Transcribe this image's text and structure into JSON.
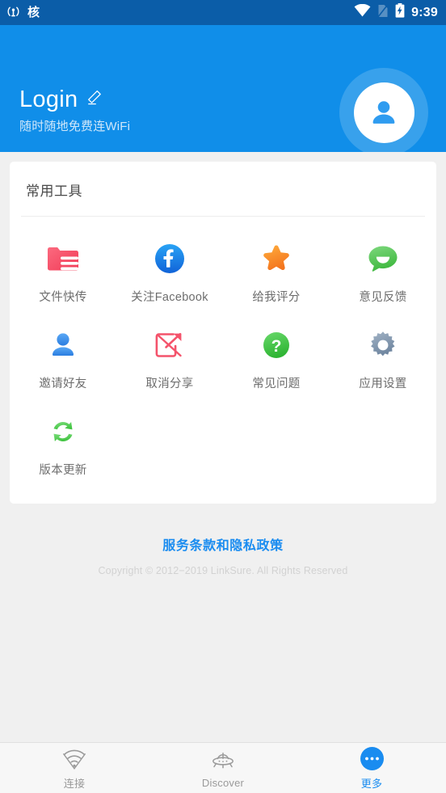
{
  "statusbar": {
    "cast_icon": "screen-cast-icon",
    "app_glyph": "核",
    "wifi_icon": "wifi-icon",
    "sim_icon": "sim-card-icon",
    "battery_icon": "battery-charging-icon",
    "time": "9:39"
  },
  "header": {
    "login_label": "Login",
    "edit_icon": "pencil-edit-icon",
    "subtitle": "随时随地免费连WiFi",
    "avatar_icon": "user-avatar-icon",
    "bg_color": "#108ee9"
  },
  "tools_card": {
    "title": "常用工具",
    "items": [
      {
        "label": "文件快传",
        "icon": "folder-transfer-icon",
        "color": "#f5516c"
      },
      {
        "label": "关注Facebook",
        "icon": "facebook-icon",
        "color": "#1877f2"
      },
      {
        "label": "给我评分",
        "icon": "star-rate-icon",
        "color": "#f99327"
      },
      {
        "label": "意见反馈",
        "icon": "feedback-bubble-icon",
        "color": "#5bc95b"
      },
      {
        "label": "邀请好友",
        "icon": "invite-friend-icon",
        "color": "#4a90e2"
      },
      {
        "label": "取消分享",
        "icon": "cancel-share-icon",
        "color": "#f5516c"
      },
      {
        "label": "常见问题",
        "icon": "faq-question-icon",
        "color": "#4cc64c"
      },
      {
        "label": "应用设置",
        "icon": "settings-gear-icon",
        "color": "#8799ab"
      },
      {
        "label": "版本更新",
        "icon": "version-update-icon",
        "color": "#5bcc5b"
      }
    ]
  },
  "footer": {
    "terms_link": "服务条款和隐私政策",
    "copyright": "Copyright © 2012−2019 LinkSure. All Rights Reserved",
    "link_color": "#1a8cf0"
  },
  "tabbar": {
    "tabs": [
      {
        "label": "连接",
        "icon": "wifi-connect-icon",
        "active": false
      },
      {
        "label": "Discover",
        "icon": "ufo-discover-icon",
        "active": false
      },
      {
        "label": "更多",
        "icon": "more-dots-icon",
        "active": true
      }
    ],
    "active_color": "#1a8cf0"
  }
}
